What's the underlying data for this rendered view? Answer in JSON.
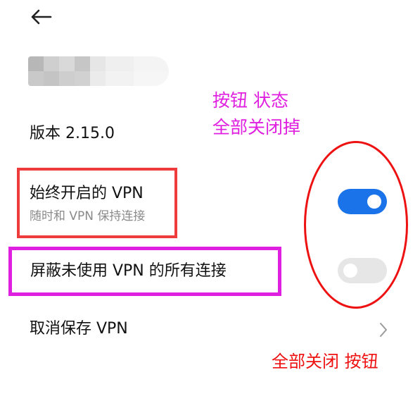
{
  "header": {
    "back_icon": "arrow-left-icon"
  },
  "app": {
    "version_label": "版本 2.15.0"
  },
  "settings": {
    "always_on": {
      "title": "始终开启的 VPN",
      "subtitle": "随时和 VPN 保持连接",
      "enabled": true
    },
    "block_without_vpn": {
      "title": "屏蔽未使用 VPN 的所有连接",
      "enabled": false
    },
    "forget": {
      "title": "取消保存 VPN",
      "chevron_icon": "chevron-right-icon"
    }
  },
  "annotations": {
    "magenta_line1": "按钮 状态",
    "magenta_line2": "全部关闭掉",
    "red_label": "全部关闭  按钮"
  },
  "colors": {
    "toggle_on": "#1a73e8",
    "toggle_off": "#e6e6e6",
    "annotation_red": "#ee1111",
    "annotation_magenta": "#e020e0"
  }
}
